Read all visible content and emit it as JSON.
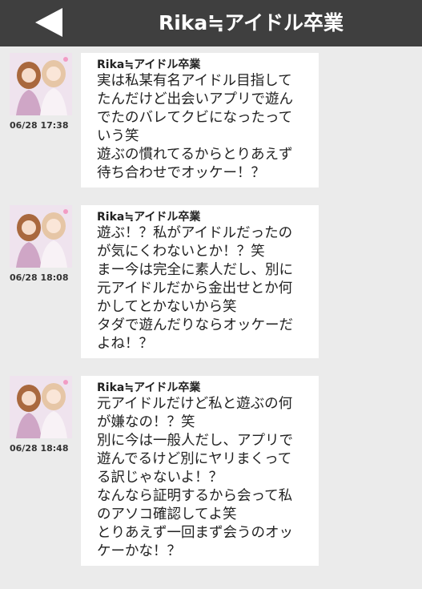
{
  "header": {
    "title": "Rika≒アイドル卒業",
    "back_icon": "back-arrow-icon"
  },
  "colors": {
    "header_bg": "#3f3f3f",
    "page_bg": "#ebebeb",
    "bubble_bg": "#ffffff"
  },
  "messages": [
    {
      "sender": "Rika≒アイドル卒業",
      "time": "06/28 17:38",
      "lines": [
        "実は私某有名アイドル目指して",
        "たんだけど出会いアプリで遊ん",
        "でたのバレてクビになったって",
        "いう笑",
        "遊ぶの慣れてるからとりあえず",
        "待ち合わせでオッケー！？"
      ]
    },
    {
      "sender": "Rika≒アイドル卒業",
      "time": "06/28 18:08",
      "lines": [
        "遊ぶ！？私がアイドルだったの",
        "が気にくわないとか！？笑",
        "まー今は完全に素人だし、別に",
        "元アイドルだから金出せとか何",
        "かしてとかないから笑",
        "タダで遊んだりならオッケーだ",
        "よね！？"
      ]
    },
    {
      "sender": "Rika≒アイドル卒業",
      "time": "06/28 18:48",
      "lines": [
        "元アイドルだけど私と遊ぶの何",
        "が嫌なの！？笑",
        "別に今は一般人だし、アプリで",
        "遊んでるけど別にヤリまくって",
        "る訳じゃないよ！？",
        "なんなら証明するから会って私",
        "のアソコ確認してよ笑",
        "とりあえず一回まず会うのオッ",
        "ケーかな！？"
      ]
    }
  ]
}
